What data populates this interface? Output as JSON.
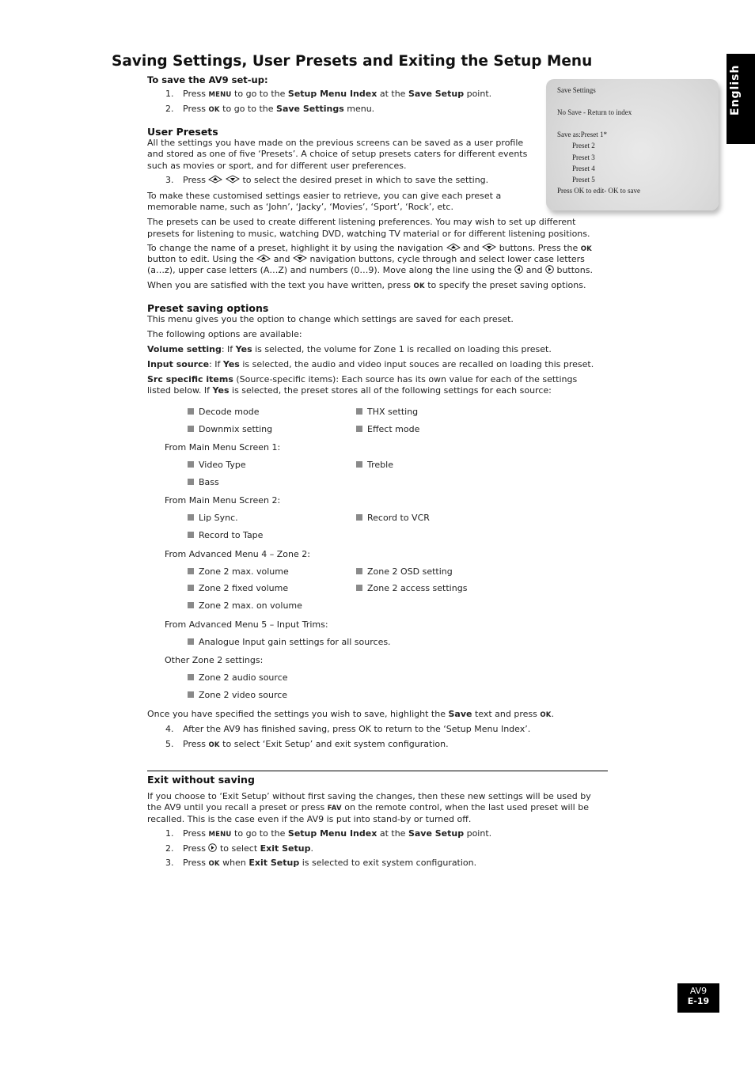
{
  "page": {
    "title": "Saving Settings, User Presets and Exiting the Setup Menu",
    "side_tab": "English",
    "footer": {
      "model": "AV9",
      "page": "E-19"
    }
  },
  "save_setup": {
    "heading": "To save the AV9 set-up:",
    "steps": [
      {
        "num": "1.",
        "parts": [
          "Press ",
          "MENU",
          " to go to the ",
          "Setup Menu Index",
          " at the ",
          "Save Setup",
          " point."
        ]
      },
      {
        "num": "2.",
        "parts": [
          "Press ",
          "OK",
          " to go to the ",
          "Save Settings",
          " menu."
        ]
      }
    ]
  },
  "osd": {
    "title": "Save Settings",
    "no_save": "No Save - Return to index",
    "save_as": "Save as:Preset 1*",
    "presets": [
      "Preset 2",
      "Preset 3",
      "Preset 4",
      "Preset 5"
    ],
    "hint": "Press OK to edit- OK to save"
  },
  "user_presets": {
    "heading": "User Presets",
    "intro": [
      "All the settings you have made on the previous screens can be saved as a user profile",
      "and stored as one of five ‘Presets’. A choice of setup presets caters for different events",
      "such as movies or sport, and for different user preferences."
    ],
    "step3": {
      "num": "3.",
      "before": "Press",
      "after": "to select the desired preset in which to save the setting."
    },
    "names_para": [
      "To make these customised settings easier to retrieve, you can give each preset a",
      "memorable name, such as ‘John’, ‘Jacky’, ‘Movies’, ‘Sport’, ‘Rock’, etc."
    ],
    "listening_para": [
      "The presets can be used to create different listening preferences. You may wish to set up different",
      "presets for listening to music, watching DVD, watching TV material or for different listening positions."
    ],
    "rename_para": {
      "l1a": "To change the name of a preset, highlight it by using the navigation",
      "l1b": "and",
      "l1c": "buttons. Press the",
      "l1d": "OK",
      "l2a": "button to edit. Using the",
      "l2b": "and",
      "l2c": "navigation buttons, cycle through and select lower case letters",
      "l3a": "(a…z), upper case letters (A…Z) and numbers (0…9). Move along the line using the",
      "l3b": "and",
      "l3c": "buttons."
    },
    "satisfied": {
      "a": "When you are satisfied with the text you have written, press ",
      "key": "OK",
      "b": " to specify the preset saving options."
    }
  },
  "preset_options": {
    "heading": "Preset saving options",
    "p1": "This menu gives you the option to change which settings are saved for each preset.",
    "p2": "The following options are available:",
    "volume": {
      "label": "Volume setting",
      "a": ": If ",
      "yes": "Yes",
      "b": " is selected, the volume for Zone 1 is recalled on loading this preset."
    },
    "input": {
      "label": "Input source",
      "a": ": If ",
      "yes": "Yes",
      "b": " is selected, the audio and video input souces are recalled on loading this preset."
    },
    "src": {
      "label": "Src specific items",
      "a": " (Source-specific items): Each source has its own value for each of the settings",
      "b": "listed below. If ",
      "yes": "Yes",
      "c": " is selected, the preset stores all of the following settings for each source:"
    },
    "groups": {
      "general": [
        "Decode mode",
        "THX setting",
        "Downmix setting",
        "Effect mode"
      ],
      "main1": {
        "label": "From Main Menu Screen 1:",
        "items": [
          "Video Type",
          "Treble",
          "Bass"
        ]
      },
      "main2": {
        "label": "From Main Menu Screen 2:",
        "items": [
          "Lip Sync.",
          "Record to VCR",
          "Record to Tape"
        ]
      },
      "adv4": {
        "label": "From Advanced Menu 4 – Zone 2:",
        "items": [
          "Zone 2 max. volume",
          "Zone 2 OSD setting",
          "Zone 2 fixed volume",
          "Zone 2 access settings",
          "Zone 2 max. on volume"
        ]
      },
      "adv5": {
        "label": "From Advanced Menu 5 – Input Trims:",
        "items": [
          "Analogue Input gain settings for all sources."
        ]
      },
      "other": {
        "label": "Other Zone 2 settings:",
        "items": [
          "Zone 2 audio source",
          "Zone 2 video source"
        ]
      }
    },
    "once": {
      "a": "Once you have specified the settings you wish to save, highlight the ",
      "save": "Save",
      "b": " text and press ",
      "key": "OK",
      "c": "."
    },
    "step4": {
      "num": "4.",
      "text": "After the AV9 has finished saving, press OK to return to the ‘Setup Menu Index’."
    },
    "step5": {
      "num": "5.",
      "a": "Press ",
      "key": "OK",
      "b": " to select ‘Exit Setup’ and exit system configuration."
    }
  },
  "exit": {
    "heading": "Exit without saving",
    "para": {
      "l1": "If you choose to ‘Exit Setup’ without first saving the changes, then these new settings will be used by",
      "l2a": "the AV9 until you recall a preset or press ",
      "l2key": "FAV",
      "l2b": " on the remote control, when the last used preset will be",
      "l3": "recalled. This is the case even if the AV9 is put into stand-by or turned off."
    },
    "steps": [
      {
        "num": "1.",
        "a": "Press ",
        "key": "MENU",
        "b": " to go to the ",
        "b1": "Setup Menu Index",
        "c": " at the ",
        "b2": "Save Setup",
        "d": " point."
      },
      {
        "num": "2.",
        "a": "Press",
        "b": " to select ",
        "bold": "Exit Setup",
        "c": "."
      },
      {
        "num": "3.",
        "a": "Press ",
        "key": "OK",
        "b": " when ",
        "bold": "Exit Setup",
        "c": " is selected to exit system configuration."
      }
    ]
  }
}
